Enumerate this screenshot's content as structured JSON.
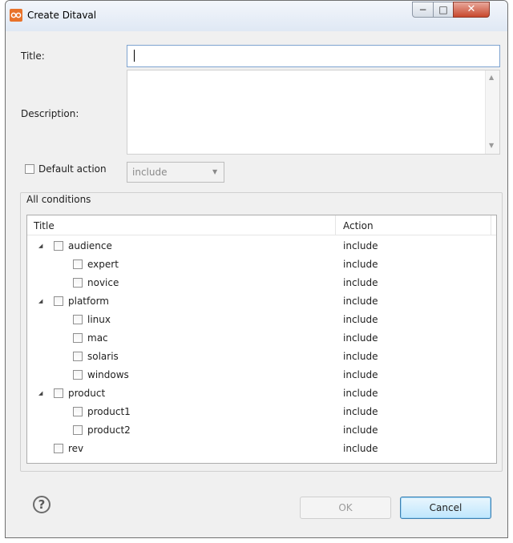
{
  "window": {
    "title": "Create Ditaval",
    "controls": {
      "minimize": "−",
      "maximize": "□",
      "close": "✕"
    }
  },
  "form": {
    "title_label": "Title:",
    "title_value": "",
    "description_label": "Description:",
    "description_value": "",
    "default_action_label": "Default action",
    "default_action_checked": false,
    "default_action_value": "include"
  },
  "conditions": {
    "group_label": "All conditions",
    "columns": {
      "title": "Title",
      "action": "Action"
    },
    "rows": [
      {
        "name": "audience",
        "action": "include",
        "level": 0,
        "expandable": true
      },
      {
        "name": "expert",
        "action": "include",
        "level": 1,
        "expandable": false
      },
      {
        "name": "novice",
        "action": "include",
        "level": 1,
        "expandable": false
      },
      {
        "name": "platform",
        "action": "include",
        "level": 0,
        "expandable": true
      },
      {
        "name": "linux",
        "action": "include",
        "level": 1,
        "expandable": false
      },
      {
        "name": "mac",
        "action": "include",
        "level": 1,
        "expandable": false
      },
      {
        "name": "solaris",
        "action": "include",
        "level": 1,
        "expandable": false
      },
      {
        "name": "windows",
        "action": "include",
        "level": 1,
        "expandable": false
      },
      {
        "name": "product",
        "action": "include",
        "level": 0,
        "expandable": true
      },
      {
        "name": "product1",
        "action": "include",
        "level": 1,
        "expandable": false
      },
      {
        "name": "product2",
        "action": "include",
        "level": 1,
        "expandable": false
      },
      {
        "name": "rev",
        "action": "include",
        "level": 0,
        "expandable": false
      }
    ]
  },
  "footer": {
    "help_glyph": "?",
    "ok_label": "OK",
    "cancel_label": "Cancel"
  },
  "colors": {
    "app_icon": "#e8722a",
    "focus_border": "#7ea3d0",
    "cancel_border": "#3c7fb1"
  },
  "icons": [
    "app-icon",
    "help-icon",
    "expand-triangle-icon",
    "dropdown-arrow-icon",
    "scroll-up-icon",
    "scroll-down-icon"
  ]
}
